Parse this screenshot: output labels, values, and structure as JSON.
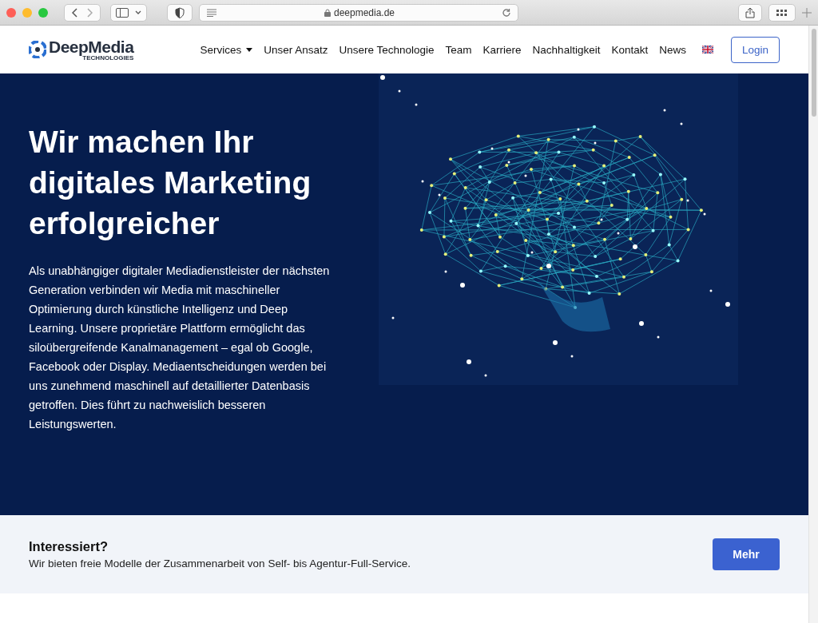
{
  "browser": {
    "url": "deepmedia.de"
  },
  "nav": {
    "logo": {
      "name": "DeepMedia",
      "sub": "TECHNOLOGIES"
    },
    "items": [
      {
        "kind": "dropdown",
        "label": "Services"
      },
      {
        "kind": "link",
        "label": "Unser Ansatz"
      },
      {
        "kind": "link",
        "label": "Unsere Technologie"
      },
      {
        "kind": "link",
        "label": "Team"
      },
      {
        "kind": "link",
        "label": "Karriere"
      },
      {
        "kind": "link",
        "label": "Nachhaltigkeit"
      },
      {
        "kind": "link",
        "label": "Kontakt"
      },
      {
        "kind": "link",
        "label": "News"
      },
      {
        "kind": "flag"
      }
    ],
    "login": "Login"
  },
  "hero": {
    "title": "Wir machen Ihr digitales Marketing erfolgreicher",
    "body": "Als unabhängiger digitaler Mediadienstleister der nächsten Generation verbinden wir Media mit maschineller Optimierung durch künstliche Intelligenz und Deep Learning. Unsere proprietäre Plattform ermöglicht das siloübergreifende Kanalmanagement – egal ob Google, Facebook oder Display. Mediaentscheidungen werden bei uns zunehmend maschinell auf detaillierter Datenbasis getroffen. Dies führt zu nachweislich besseren Leistungswerten."
  },
  "cta": {
    "title": "Interessiert?",
    "text": "Wir bieten freie Modelle der Zusammenarbeit von Self- bis Agentur-Full-Service.",
    "button": "Mehr"
  }
}
